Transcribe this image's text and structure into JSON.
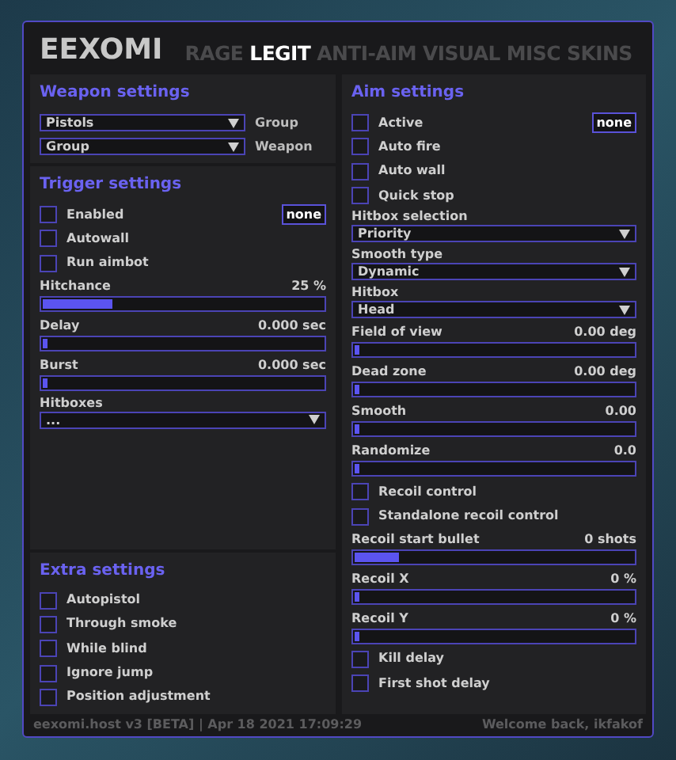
{
  "logo": "EEXOMI",
  "tabs": [
    {
      "label": "RAGE",
      "selected": false
    },
    {
      "label": "LEGIT",
      "selected": true
    },
    {
      "label": "ANTI-AIM",
      "selected": false
    },
    {
      "label": "VISUAL",
      "selected": false
    },
    {
      "label": "MISC",
      "selected": false
    },
    {
      "label": "SKINS",
      "selected": false
    }
  ],
  "left_panels": [
    {
      "title": "Weapon settings",
      "items": [
        {
          "kind": "select",
          "value": "Pistols",
          "side_label": "Group"
        },
        {
          "kind": "select",
          "value": "Group",
          "side_label": "Weapon"
        }
      ]
    },
    {
      "title": "Trigger settings",
      "items": [
        {
          "kind": "check",
          "label": "Enabled",
          "checked": false,
          "hotkey": "none"
        },
        {
          "kind": "check",
          "label": "Autowall",
          "checked": false
        },
        {
          "kind": "check",
          "label": "Run aimbot",
          "checked": false
        },
        {
          "kind": "slider",
          "label": "Hitchance",
          "reading": "25 %",
          "level": 0.25
        },
        {
          "kind": "slider",
          "label": "Delay",
          "reading": "0.000 sec",
          "level": 0
        },
        {
          "kind": "slider",
          "label": "Burst",
          "reading": "0.000 sec",
          "level": 0
        },
        {
          "kind": "select",
          "label": "Hitboxes",
          "value": "..."
        }
      ]
    },
    {
      "title": "Extra settings",
      "items": [
        {
          "kind": "check",
          "label": "Autopistol",
          "checked": false
        },
        {
          "kind": "check",
          "label": "Through smoke",
          "checked": false
        },
        {
          "kind": "check",
          "label": "While blind",
          "checked": false
        },
        {
          "kind": "check",
          "label": "Ignore jump",
          "checked": false
        },
        {
          "kind": "check",
          "label": "Position adjustment",
          "checked": false
        }
      ]
    }
  ],
  "right_panels": [
    {
      "title": "Aim settings",
      "items": [
        {
          "kind": "check",
          "label": "Active",
          "checked": false,
          "hotkey": "none"
        },
        {
          "kind": "check",
          "label": "Auto fire",
          "checked": false
        },
        {
          "kind": "check",
          "label": "Auto wall",
          "checked": false
        },
        {
          "kind": "check",
          "label": "Quick stop",
          "checked": false
        },
        {
          "kind": "select",
          "label": "Hitbox selection",
          "value": "Priority"
        },
        {
          "kind": "select",
          "label": "Smooth type",
          "value": "Dynamic"
        },
        {
          "kind": "select",
          "label": "Hitbox",
          "value": "Head"
        },
        {
          "kind": "slider",
          "label": "Field of view",
          "reading": "0.00 deg",
          "level": 0
        },
        {
          "kind": "slider",
          "label": "Dead zone",
          "reading": "0.00 deg",
          "level": 0
        },
        {
          "kind": "slider",
          "label": "Smooth",
          "reading": "0.00",
          "level": 0
        },
        {
          "kind": "slider",
          "label": "Randomize",
          "reading": "0.0",
          "level": 0
        },
        {
          "kind": "check",
          "label": "Recoil control",
          "checked": false
        },
        {
          "kind": "check",
          "label": "Standalone recoil control",
          "checked": false
        },
        {
          "kind": "slider",
          "label": "Recoil start bullet",
          "reading": "0 shots",
          "level": 0.16
        },
        {
          "kind": "slider",
          "label": "Recoil X",
          "reading": "0 %",
          "level": 0
        },
        {
          "kind": "slider",
          "label": "Recoil Y",
          "reading": "0 %",
          "level": 0
        },
        {
          "kind": "check",
          "label": "Kill delay",
          "checked": false
        },
        {
          "kind": "check",
          "label": "First shot delay",
          "checked": false
        }
      ]
    }
  ],
  "status_bar": {
    "left": "eexomi.host v3 [BETA] | Apr 18 2021 17:09:29",
    "right": "Welcome back, ikfakof"
  }
}
